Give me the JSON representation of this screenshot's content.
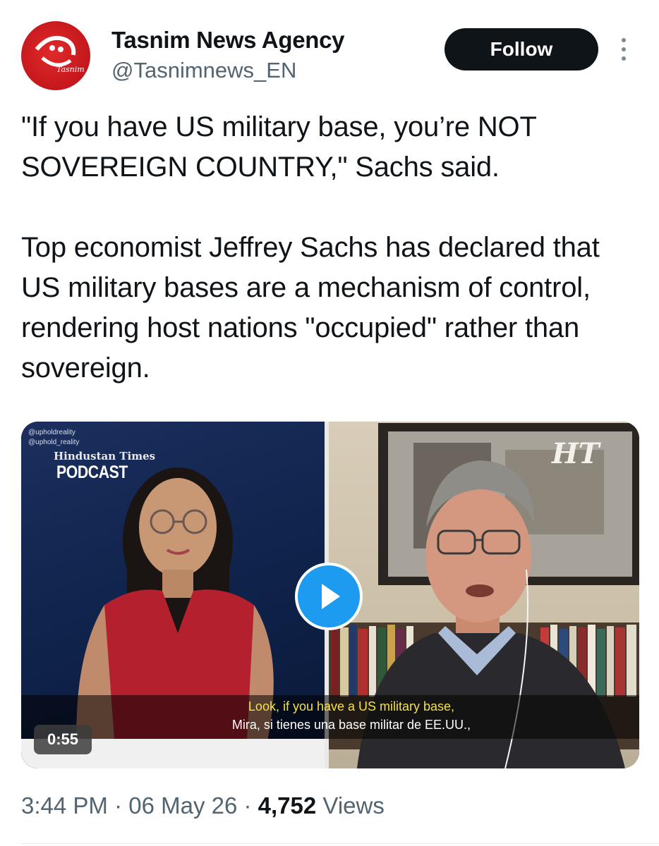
{
  "account": {
    "name": "Tasnim News Agency",
    "handle": "@Tasnimnews_EN",
    "avatar_text": "Tasnim",
    "follow_label": "Follow"
  },
  "tweet": {
    "text": "\"If you have US military base, you’re NOT SOVEREIGN COUNTRY,\" Sachs said.\n\nTop economist Jeffrey Sachs has declared that US military bases are a mechanism of control, rendering host nations \"occupied\" rather than sovereign."
  },
  "media": {
    "watermark_1": "@upholdreality",
    "watermark_2": "@uphold_reality",
    "show_brand": "Hindustan Times",
    "show_title": "PODCAST",
    "logo": "HT",
    "caption_en": "Look, if you have a US military base,",
    "caption_es": "Mira, si tienes una base militar de EE.UU.,",
    "duration": "0:55",
    "play_icon": "play-icon"
  },
  "meta": {
    "time": "3:44 PM",
    "date": "06 May 26",
    "sep": " · ",
    "views_count": "4,752",
    "views_label": "Views"
  },
  "colors": {
    "accent": "#1d9bf0",
    "text_primary": "#0f1419",
    "text_secondary": "#536471",
    "avatar_red": "#d11f26"
  }
}
